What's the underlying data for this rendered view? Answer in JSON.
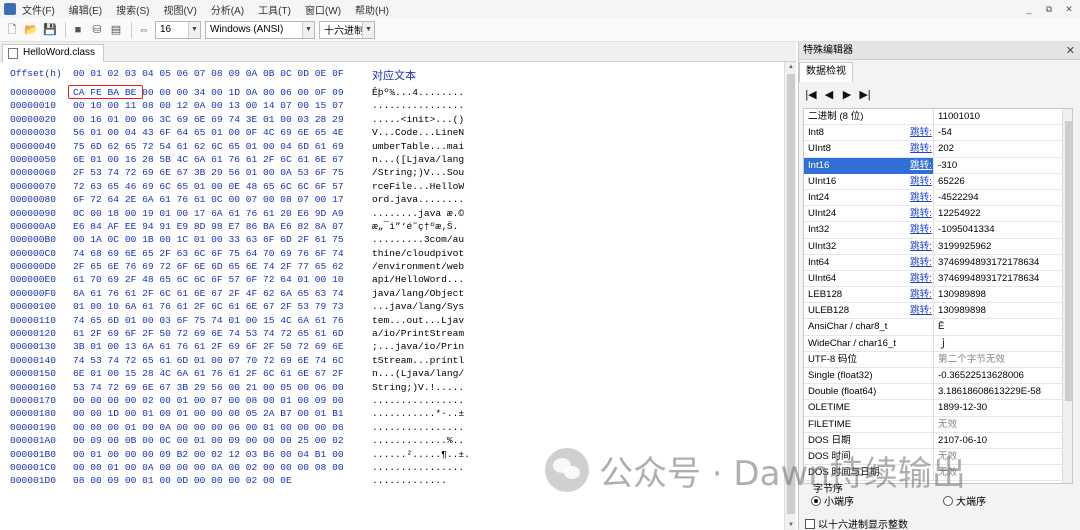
{
  "menubar": {
    "items": [
      "文件(F)",
      "编辑(E)",
      "搜索(S)",
      "视图(V)",
      "分析(A)",
      "工具(T)",
      "窗口(W)",
      "帮助(H)"
    ],
    "window_controls": [
      "_",
      "⧉",
      "✕"
    ]
  },
  "toolbar": {
    "bytes_per_row": "16",
    "encoding": "Windows (ANSI)",
    "offset_base": "十六进制"
  },
  "file_tab": {
    "name": "HelloWord.class"
  },
  "hex": {
    "header_offset": "Offset(h)",
    "header_cols": "00 01 02 03 04 05 06 07 08 09 0A 0B 0C 0D 0E 0F",
    "header_text": "对应文本",
    "rows": [
      {
        "off": "00000000",
        "bytes": "CA FE BA BE 00 00 00 34 00 1D 0A 00 06 00 0F 09",
        "ascii": "Êþº¾...4........"
      },
      {
        "off": "00000010",
        "bytes": "00 10 00 11 08 00 12 0A 00 13 00 14 07 00 15 07",
        "ascii": "................"
      },
      {
        "off": "00000020",
        "bytes": "00 16 01 00 06 3C 69 6E 69 74 3E 01 00 03 28 29",
        "ascii": ".....<init>...()"
      },
      {
        "off": "00000030",
        "bytes": "56 01 00 04 43 6F 64 65 01 00 0F 4C 69 6E 65 4E",
        "ascii": "V...Code...LineN"
      },
      {
        "off": "00000040",
        "bytes": "75 6D 62 65 72 54 61 62 6C 65 01 00 04 6D 61 69",
        "ascii": "umberTable...mai"
      },
      {
        "off": "00000050",
        "bytes": "6E 01 00 16 28 5B 4C 6A 61 76 61 2F 6C 61 6E 67",
        "ascii": "n...([Ljava/lang"
      },
      {
        "off": "00000060",
        "bytes": "2F 53 74 72 69 6E 67 3B 29 56 01 00 0A 53 6F 75",
        "ascii": "/String;)V...Sou"
      },
      {
        "off": "00000070",
        "bytes": "72 63 65 46 69 6C 65 01 00 0E 48 65 6C 6C 6F 57",
        "ascii": "rceFile...HelloW"
      },
      {
        "off": "00000080",
        "bytes": "6F 72 64 2E 6A 61 76 61 0C 00 07 00 08 07 00 17",
        "ascii": "ord.java........"
      },
      {
        "off": "00000090",
        "bytes": "0C 00 18 00 19 01 00 17 6A 61 76 61 20 E6 9D A9",
        "ascii": "........java æ.©"
      },
      {
        "off": "000000A0",
        "bytes": "E6 84 AF EE 94 91 E9 8D 98 E7 86 BA E6 82 8A 07",
        "ascii": "æ„¯î”‘é˜ç†ºæ‚Š."
      },
      {
        "off": "000000B0",
        "bytes": "00 1A 0C 00 1B 00 1C 01 00 33 63 6F 6D 2F 61 75",
        "ascii": ".........3com/au"
      },
      {
        "off": "000000C0",
        "bytes": "74 68 69 6E 65 2F 63 6C 6F 75 64 70 69 76 6F 74",
        "ascii": "thine/cloudpivot"
      },
      {
        "off": "000000D0",
        "bytes": "2F 65 6E 76 69 72 6F 6E 6D 65 6E 74 2F 77 65 62",
        "ascii": "/environment/web"
      },
      {
        "off": "000000E0",
        "bytes": "61 70 69 2F 48 65 6C 6C 6F 57 6F 72 64 01 00 10",
        "ascii": "api/HelloWord..."
      },
      {
        "off": "000000F0",
        "bytes": "6A 61 76 61 2F 6C 61 6E 67 2F 4F 62 6A 65 63 74",
        "ascii": "java/lang/Object"
      },
      {
        "off": "00000100",
        "bytes": "01 00 10 6A 61 76 61 2F 6C 61 6E 67 2F 53 79 73",
        "ascii": "...java/lang/Sys"
      },
      {
        "off": "00000110",
        "bytes": "74 65 6D 01 00 03 6F 75 74 01 00 15 4C 6A 61 76",
        "ascii": "tem...out...Ljav"
      },
      {
        "off": "00000120",
        "bytes": "61 2F 69 6F 2F 50 72 69 6E 74 53 74 72 65 61 6D",
        "ascii": "a/io/PrintStream"
      },
      {
        "off": "00000130",
        "bytes": "3B 01 00 13 6A 61 76 61 2F 69 6F 2F 50 72 69 6E",
        "ascii": ";...java/io/Prin"
      },
      {
        "off": "00000140",
        "bytes": "74 53 74 72 65 61 6D 01 00 07 70 72 69 6E 74 6C",
        "ascii": "tStream...printl"
      },
      {
        "off": "00000150",
        "bytes": "6E 01 00 15 28 4C 6A 61 76 61 2F 6C 61 6E 67 2F",
        "ascii": "n...(Ljava/lang/"
      },
      {
        "off": "00000160",
        "bytes": "53 74 72 69 6E 67 3B 29 56 00 21 00 05 00 06 00",
        "ascii": "String;)V.!....."
      },
      {
        "off": "00000170",
        "bytes": "00 00 00 00 02 00 01 00 07 00 08 00 01 00 09 00",
        "ascii": "................"
      },
      {
        "off": "00000180",
        "bytes": "00 00 1D 00 01 00 01 00 00 00 05 2A B7 00 01 B1",
        "ascii": "...........*·..±"
      },
      {
        "off": "00000190",
        "bytes": "00 00 00 01 00 0A 00 00 00 06 00 01 00 00 00 06",
        "ascii": "................"
      },
      {
        "off": "000001A0",
        "bytes": "00 09 00 0B 00 0C 00 01 00 09 00 00 00 25 00 02",
        "ascii": ".............%.."
      },
      {
        "off": "000001B0",
        "bytes": "00 01 00 00 00 09 B2 00 02 12 03 B6 00 04 B1 00",
        "ascii": "......².....¶..±."
      },
      {
        "off": "000001C0",
        "bytes": "00 00 01 00 0A 00 00 00 0A 00 02 00 00 00 08 00",
        "ascii": "................"
      },
      {
        "off": "000001D0",
        "bytes": "08 00 09 00 01 00 0D 00 00 00 02 00 0E",
        "ascii": "............."
      }
    ]
  },
  "panel": {
    "title": "特殊编辑器",
    "tab": "数据检视",
    "nav": [
      "|◀",
      "◀",
      "▶",
      "▶|"
    ],
    "jump_label": "跳转:",
    "rows": [
      {
        "name": "二进制 (8 位)",
        "value": "11001010",
        "jump": false
      },
      {
        "name": "Int8",
        "value": "-54",
        "jump": true
      },
      {
        "name": "UInt8",
        "value": "202",
        "jump": true
      },
      {
        "name": "Int16",
        "value": "-310",
        "jump": true,
        "selected": true
      },
      {
        "name": "UInt16",
        "value": "65226",
        "jump": true
      },
      {
        "name": "Int24",
        "value": "-4522294",
        "jump": true
      },
      {
        "name": "UInt24",
        "value": "12254922",
        "jump": true
      },
      {
        "name": "Int32",
        "value": "-1095041334",
        "jump": true
      },
      {
        "name": "UInt32",
        "value": "3199925962",
        "jump": true
      },
      {
        "name": "Int64",
        "value": "3746994893172178634",
        "jump": true
      },
      {
        "name": "UInt64",
        "value": "3746994893172178634",
        "jump": true
      },
      {
        "name": "LEB128",
        "value": "130989898",
        "jump": true
      },
      {
        "name": "ULEB128",
        "value": "130989898",
        "jump": true
      },
      {
        "name": "AnsiChar / char8_t",
        "value": "Ê",
        "jump": false
      },
      {
        "name": "WideChar / char16_t",
        "value": "ｊ",
        "jump": false
      },
      {
        "name": "UTF-8 码位",
        "value": "第二个字节无效",
        "jump": false,
        "gray": true
      },
      {
        "name": "Single (float32)",
        "value": "-0.36522513628006",
        "jump": false
      },
      {
        "name": "Double (float64)",
        "value": "3.18618608613229E-58",
        "jump": false
      },
      {
        "name": "OLETIME",
        "value": "1899-12-30",
        "jump": false
      },
      {
        "name": "FILETIME",
        "value": "无效",
        "jump": false,
        "gray": true
      },
      {
        "name": "DOS 日期",
        "value": "2107-06-10",
        "jump": false
      },
      {
        "name": "DOS 时间",
        "value": "无效",
        "jump": false,
        "gray": true
      },
      {
        "name": "DOS 时间与日期",
        "value": "无效",
        "jump": false,
        "gray": true
      }
    ],
    "byteorder_legend": "字节序",
    "little_endian": "小端序",
    "big_endian": "大端序",
    "hex_int_label": "以十六进制显示整数"
  },
  "watermark": {
    "text": "公众号 · Dawn持续输出"
  },
  "colors": {
    "hex_blue": "#1a33b5",
    "selected_bg": "#2f6fd6",
    "highlight_red": "#e02020",
    "link_blue": "#2040d0"
  }
}
